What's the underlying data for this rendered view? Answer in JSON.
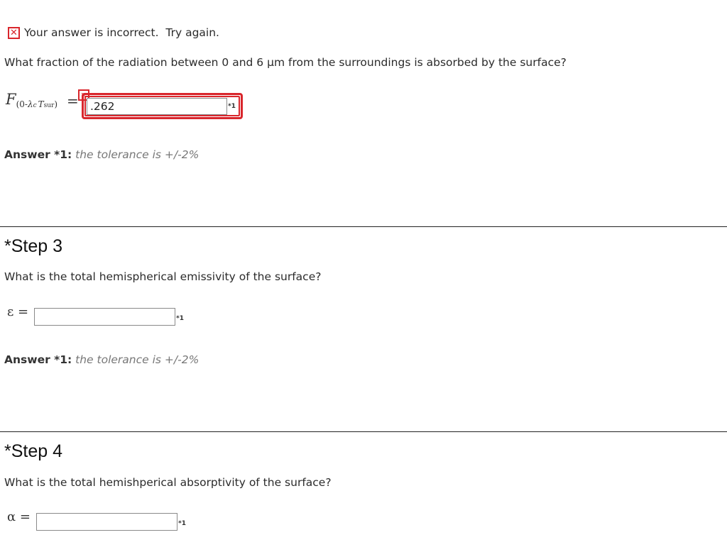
{
  "feedback": {
    "message": "Your answer is incorrect.  Try again."
  },
  "step2": {
    "question": "What fraction of the radiation between 0 and 6 μm from the surroundings is absorbed by the surface?",
    "var_main": "F",
    "var_sub_open": "(0-",
    "var_sub_lambda": "λ",
    "var_sub_c": "c",
    "var_sub_T": "T",
    "var_sub_sur": "sur",
    "var_sub_close": ")",
    "equals": "=",
    "input_value": ".262",
    "marker": "*1",
    "answer_label": "Answer *1:",
    "tolerance": "the tolerance is +/-2%"
  },
  "step3": {
    "title": "*Step 3",
    "question": "What is the total hemispherical emissivity of the surface?",
    "var": "ε =",
    "input_value": "",
    "marker": "*1",
    "answer_label": "Answer *1:",
    "tolerance": "the tolerance is +/-2%"
  },
  "step4": {
    "title": "*Step 4",
    "question": "What is the total hemishperical absorptivity of the surface?",
    "var": "α =",
    "input_value": "",
    "marker": "*1"
  },
  "colors": {
    "error_red": "#d9262c",
    "tolerance_gray": "#777777"
  },
  "icons": {
    "error": "close-icon"
  }
}
